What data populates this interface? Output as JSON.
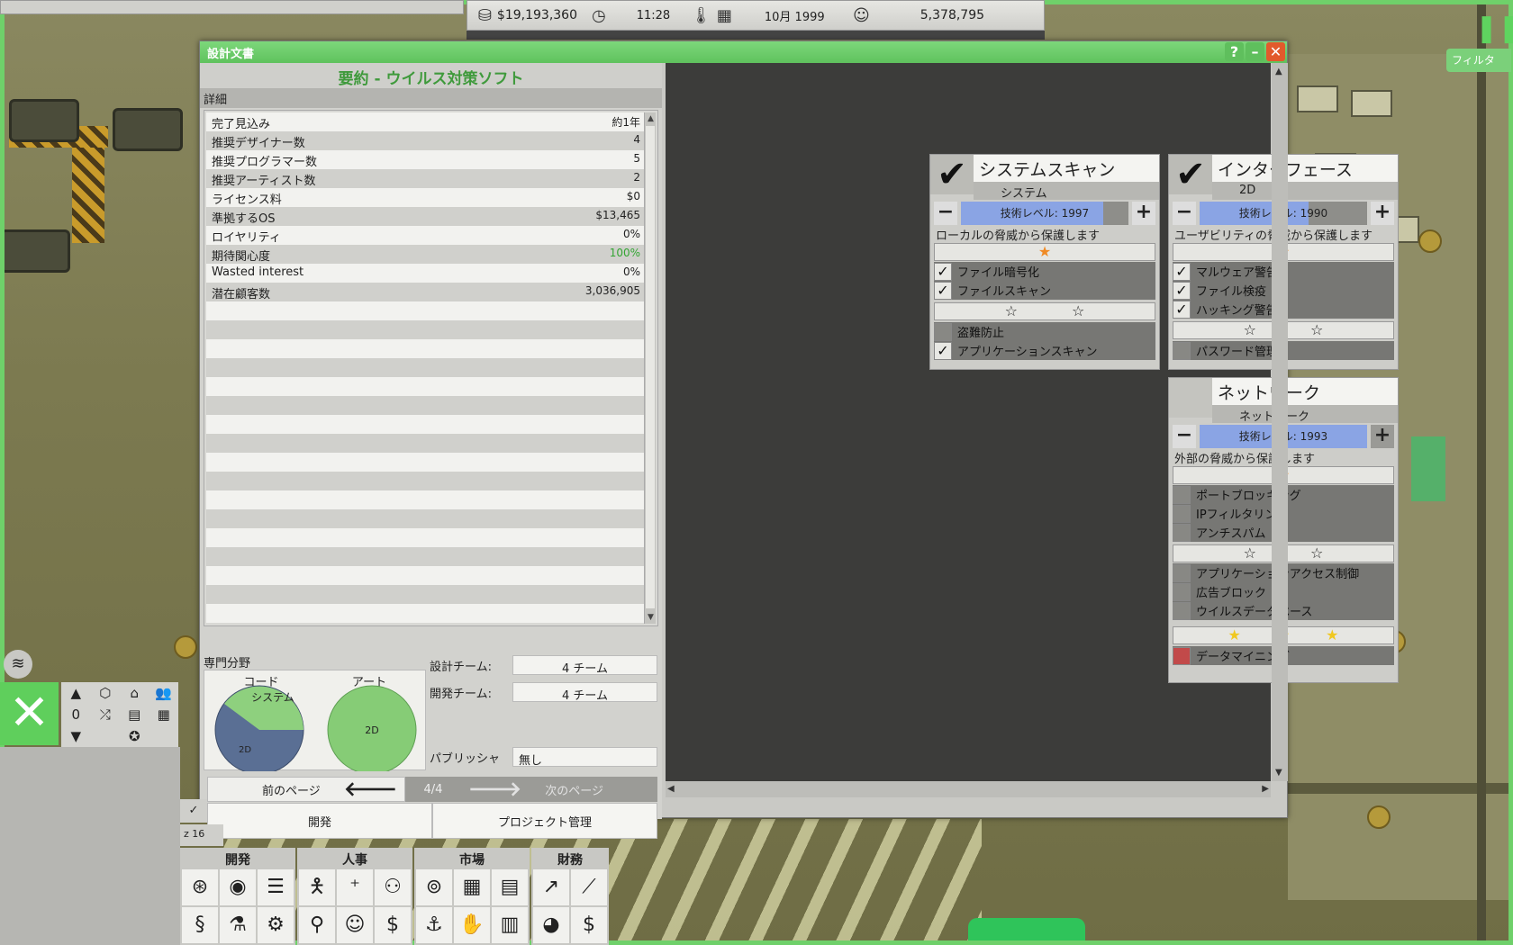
{
  "status": {
    "money": "$19,193,360",
    "time": "11:28",
    "date": "10月 1999",
    "fans": "5,378,795"
  },
  "filter_label": "フィルタ",
  "dialog": {
    "title": "設計文書",
    "summary_prefix": "要約",
    "summary_sep": " - ",
    "product": "ウイルス対策ソフト",
    "details_label": "詳細",
    "details": [
      {
        "k": "完了見込み",
        "v": "約1年"
      },
      {
        "k": "推奨デザイナー数",
        "v": "4"
      },
      {
        "k": "推奨プログラマー数",
        "v": "5"
      },
      {
        "k": "推奨アーティスト数",
        "v": "2"
      },
      {
        "k": "ライセンス料",
        "v": "$0"
      },
      {
        "k": "準拠するOS",
        "v": "$13,465"
      },
      {
        "k": "ロイヤリティ",
        "v": "0%"
      },
      {
        "k": "期待関心度",
        "v": "100%"
      },
      {
        "k": "Wasted interest",
        "v": "0%"
      },
      {
        "k": "潜在顧客数",
        "v": "3,036,905"
      }
    ],
    "spec_label": "専門分野",
    "code_label": "コード",
    "art_label": "アート",
    "pie_code_a": "システム",
    "pie_code_b": "2D",
    "pie_art": "2D",
    "design_team_label": "設計チーム:",
    "design_team": "4 チーム",
    "dev_team_label": "開発チーム:",
    "dev_team": "4 チーム",
    "publisher_label": "パブリッシャ",
    "publisher": "無し",
    "prev_page": "前のページ",
    "page": "4/4",
    "next_page": "次のページ",
    "develop": "開発",
    "project_mgmt": "プロジェクト管理"
  },
  "features": {
    "system_scan": {
      "title": "システムスキャン",
      "sub": "システム",
      "tech": "技術レベル: 1997",
      "tech_level": 0.85,
      "desc": "ローカルの脅威から保護します",
      "opts": [
        "ファイル暗号化",
        "ファイルスキャン",
        "盗難防止",
        "アプリケーションスキャン"
      ]
    },
    "interface": {
      "title": "インターフェース",
      "sub": "2D",
      "tech": "技術レベル: 1990",
      "tech_level": 0.65,
      "desc": "ユーザビリティの脅威から保護します",
      "opts": [
        "マルウェア警告",
        "ファイル検疫",
        "ハッキング警告",
        "パスワード管理"
      ]
    },
    "network": {
      "title": "ネットワーク",
      "sub": "ネットワーク",
      "tech": "技術レベル: 1993",
      "tech_level": 1.0,
      "desc": "外部の脅威から保護します",
      "opts": [
        "ポートブロッキング",
        "IPフィルタリング",
        "アンチスパム",
        "アプリケーションアクセス制御",
        "広告ブロック",
        "ウイルスデータベース",
        "データマイニング"
      ]
    }
  },
  "toolbar": {
    "zero": "0",
    "employees": "16",
    "groups": [
      "開発",
      "人事",
      "市場",
      "財務"
    ]
  }
}
